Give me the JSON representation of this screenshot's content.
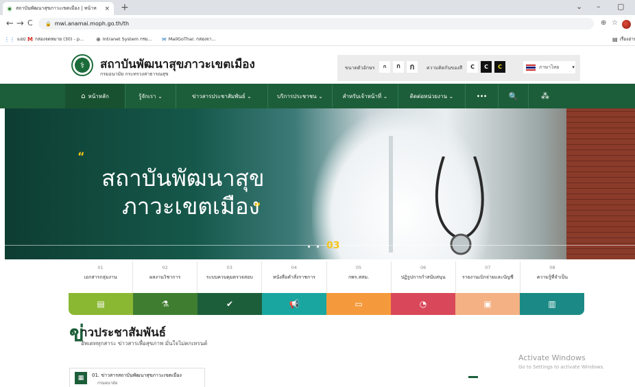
{
  "browser": {
    "tab_title": "สถาบันพัฒนาสุขภาวะเขตเมือง | หน้าห",
    "tab_close": "×",
    "new_tab": "+",
    "window_controls": [
      "⌄",
      "–",
      "▢"
    ],
    "nav_buttons": [
      "←",
      "→",
      "C"
    ],
    "url": "mwi.anamai.moph.go.th/th",
    "toolbar_icons": [
      "⊕",
      "☆"
    ],
    "bookmarks": [
      {
        "icon": "grid-icon",
        "label": "แอป"
      },
      {
        "icon": "gmail-icon",
        "label": "กล่องจดหมาย (30) - p..."
      },
      {
        "icon": "globe-icon",
        "label": "Intranet System กรม..."
      },
      {
        "icon": "mailgothai-icon",
        "label": "MailGoThai: กล่องจา..."
      }
    ],
    "reading_list": "เรื่องอ่าน"
  },
  "site": {
    "org_name": "สถาบันพัฒนาสุขภาวะเขตเมือง",
    "org_sub": "กรมอนามัย กระทรวงสาธารณสุข",
    "logo_glyph": "⚕",
    "accessibility": {
      "font_size_label": "ขนาดตัวอักษร",
      "font_sizes": [
        "ก",
        "ก",
        "ก"
      ],
      "contrast_label": "ความคิดกันของสี",
      "contrast_options": [
        "C",
        "C",
        "C"
      ],
      "language": "ภาษาไทย",
      "language_caret": "▾"
    },
    "nav": [
      {
        "label": "หน้าหลัก",
        "icon": "home-icon",
        "glyph": "⌂"
      },
      {
        "label": "รู้จักเรา ⌄"
      },
      {
        "label": "ข่าวสารประชาสัมพันธ์ ⌄"
      },
      {
        "label": "บริการประชาชน ⌄"
      },
      {
        "label": "สำหรับเจ้าหน้าที่ ⌄"
      },
      {
        "label": "ติดต่อหน่วยงาน ⌄"
      },
      {
        "label": "•••"
      },
      {
        "label": "🔍"
      },
      {
        "label": "⁂"
      }
    ],
    "hero": {
      "quote_open": "“",
      "line1": "สถาบันพัฒนาสุข",
      "line2": "ภาวะเขตเมือง",
      "quote_close": "”",
      "slide_number": "03"
    },
    "quick_links": [
      {
        "num": "01",
        "label": "เอกสารกลุ่มงาน"
      },
      {
        "num": "02",
        "label": "ผลงานวิชาการ"
      },
      {
        "num": "03",
        "label": "ระบบควบคุมตรวจสอบ"
      },
      {
        "num": "04",
        "label": "หนังสือคำสั่งราชการ"
      },
      {
        "num": "05",
        "label": "กพร.สสม."
      },
      {
        "num": "06",
        "label": "ปฏิรูปการกำสนับสนุน"
      },
      {
        "num": "07",
        "label": "รายงานเบิกจ่ายและบัญชี"
      },
      {
        "num": "08",
        "label": "ความรู้ที่จำเป็น"
      }
    ],
    "color_bar": [
      {
        "color": "#8bb833",
        "icon": "document-icon",
        "glyph": "▤"
      },
      {
        "color": "#3f7e31",
        "icon": "flask-icon",
        "glyph": "⚗"
      },
      {
        "color": "#1d5e3a",
        "icon": "check-icon",
        "glyph": "✔"
      },
      {
        "color": "#1aa6a0",
        "icon": "megaphone-icon",
        "glyph": "📢"
      },
      {
        "color": "#f59a3c",
        "icon": "id-card-icon",
        "glyph": "▭"
      },
      {
        "color": "#d9485a",
        "icon": "gauge-icon",
        "glyph": "◔"
      },
      {
        "color": "#f4b183",
        "icon": "money-icon",
        "glyph": "▣"
      },
      {
        "color": "#1b8a86",
        "icon": "book-icon",
        "glyph": "▥"
      }
    ],
    "news": {
      "mark": "ข่",
      "title": "าวประชาสัมพันธ์",
      "subtitle": "อัพเดททุกสาระ ข่าวสารเพื่อสุขภาพ มั่นใจไม่ตกเทรนด์",
      "card_title": "01. ข่าวสารสถาบันพัฒนาสุขภาวะเขตเมือง",
      "card_sub": "กรมอนามัย"
    }
  },
  "overlay": {
    "activate_title": "Activate Windows",
    "activate_sub": "Go to Settings to activate Windows."
  }
}
